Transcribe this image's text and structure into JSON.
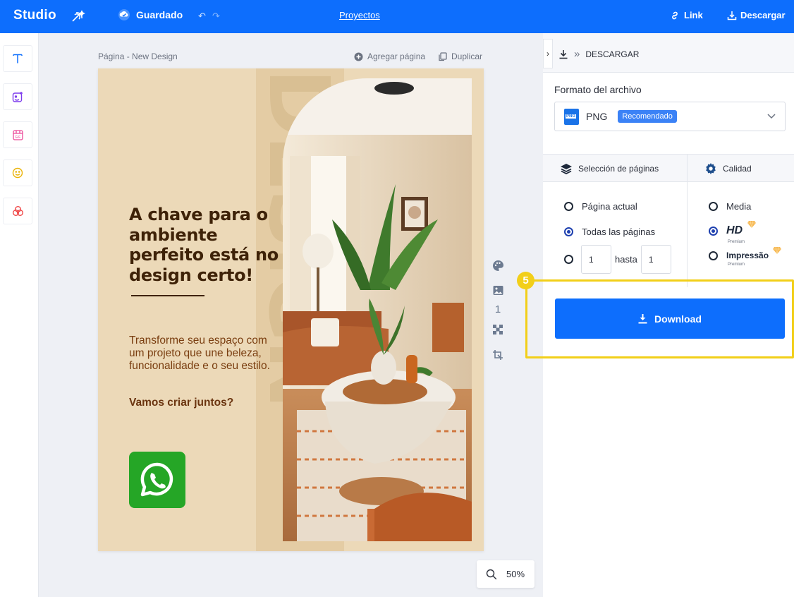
{
  "topbar": {
    "logo": "Studio",
    "saved_label": "Guardado",
    "projects_label": "Proyectos",
    "link_label": "Link",
    "download_label": "Descargar",
    "accent": "#0d6efd"
  },
  "leftbar": {
    "tools": [
      "text-icon",
      "image-sparkle-icon",
      "gif-icon",
      "smiley-icon",
      "shapes-icon"
    ]
  },
  "canvas": {
    "page_label": "Página - New Design",
    "add_page_label": "Agregar página",
    "duplicate_label": "Duplicar",
    "page_number": "1",
    "zoom": "50%"
  },
  "design": {
    "headline": "A chave para o ambiente perfeito está no design certo!",
    "body": "Transforme seu espaço com um projeto que une beleza, funcionalidade e o seu estilo.",
    "cta": "Vamos criar juntos?",
    "background_word": "DESIGN"
  },
  "panel": {
    "header": "DESCARGAR",
    "format_label": "Formato del archivo",
    "format_value": "PNG",
    "format_badge": "Recomendado",
    "pages_tab": "Selección de páginas",
    "quality_tab": "Calidad",
    "pages_options": {
      "current": "Página actual",
      "all": "Todas las páginas",
      "range_from": "1",
      "range_to_label": "hasta",
      "range_to": "1",
      "selected": "all"
    },
    "quality_options": {
      "media": "Media",
      "hd": "HD",
      "hd_sub": "Premium",
      "impressao": "Impressão",
      "impressao_sub": "Premium",
      "selected": "hd"
    },
    "step_number": "5",
    "download_button": "Download",
    "highlight_color": "#f2cf19"
  }
}
